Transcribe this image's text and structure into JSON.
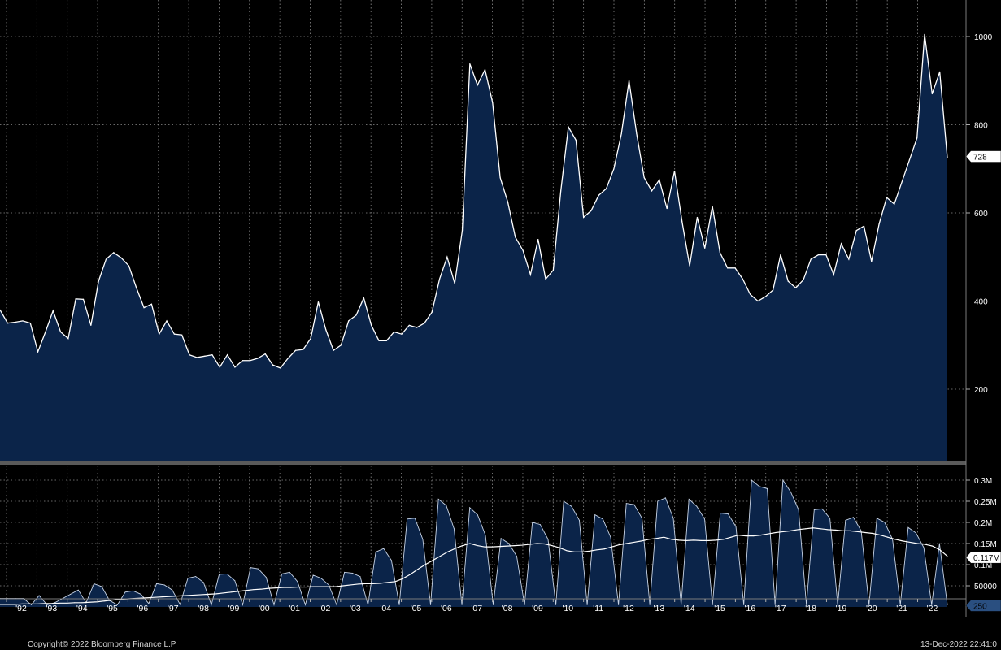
{
  "chart_data": [
    {
      "type": "area",
      "panel": "upper",
      "title": "",
      "xlabel": "",
      "ylabel": "",
      "ylim": [
        50,
        1050
      ],
      "yticks": [
        200,
        400,
        600,
        800,
        1000
      ],
      "grid": true,
      "legend": "none",
      "last_value_label": "728",
      "series": [
        {
          "values": [
            380,
            350,
            352,
            355,
            350,
            285,
            330,
            378,
            330,
            315,
            405,
            404,
            345,
            445,
            495,
            510,
            498,
            480,
            430,
            385,
            393,
            325,
            355,
            325,
            323,
            278,
            272,
            275,
            278,
            250,
            278,
            250,
            265,
            265,
            270,
            280,
            255,
            248,
            270,
            288,
            290,
            315,
            398,
            335,
            288,
            300,
            355,
            368,
            407,
            345,
            310,
            310,
            330,
            325,
            345,
            340,
            350,
            375,
            450,
            500,
            440,
            560,
            938,
            890,
            925,
            850,
            680,
            625,
            545,
            515,
            460,
            540,
            450,
            470,
            650,
            795,
            765,
            590,
            605,
            640,
            655,
            700,
            780,
            900,
            780,
            680,
            650,
            675,
            610,
            695,
            580,
            480,
            590,
            520,
            615,
            510,
            475,
            475,
            450,
            415,
            400,
            410,
            425,
            505,
            445,
            430,
            448,
            495,
            505,
            505,
            460,
            530,
            495,
            560,
            570,
            490,
            575,
            635,
            620,
            670,
            720,
            770,
            1005,
            870,
            920,
            725
          ],
          "color": "#ffffff"
        }
      ]
    },
    {
      "type": "area",
      "panel": "lower",
      "title": "",
      "xlabel": "",
      "ylabel": "",
      "ylim": [
        0,
        300000
      ],
      "yticks": [
        "0.3M",
        "0.25M",
        "0.2M",
        "0.15M",
        "0.1M",
        "50000"
      ],
      "grid": true,
      "legend": "none",
      "last_value_labels": [
        "0.117M",
        "250"
      ],
      "series": [
        {
          "values": [
            20000,
            20000,
            20000,
            20000,
            5000,
            27000,
            5000,
            10000,
            20000,
            30000,
            40000,
            10000,
            55000,
            48000,
            15000,
            5000,
            35000,
            38000,
            30000,
            8000,
            55000,
            52000,
            40000,
            6000,
            68000,
            72000,
            58000,
            5000,
            77000,
            78000,
            62000,
            5000,
            93000,
            90000,
            70000,
            5000,
            78000,
            82000,
            60000,
            5000,
            75000,
            68000,
            52000,
            5000,
            82000,
            80000,
            72000,
            5000,
            130000,
            138000,
            110000,
            5000,
            208000,
            210000,
            160000,
            5000,
            255000,
            240000,
            185000,
            5000,
            235000,
            218000,
            170000,
            5000,
            162000,
            150000,
            120000,
            5000,
            200000,
            195000,
            160000,
            5000,
            250000,
            238000,
            205000,
            5000,
            218000,
            208000,
            165000,
            5000,
            245000,
            242000,
            210000,
            5000,
            250000,
            258000,
            210000,
            5000,
            255000,
            238000,
            208000,
            5000,
            222000,
            220000,
            190000,
            5000,
            300000,
            285000,
            280000,
            5000,
            300000,
            272000,
            230000,
            5000,
            230000,
            232000,
            210000,
            5000,
            205000,
            212000,
            180000,
            5000,
            210000,
            200000,
            160000,
            5000,
            188000,
            175000,
            140000,
            5000,
            150000,
            5000
          ],
          "color": "#ffffff"
        },
        {
          "values": [
            6000,
            6000,
            6000,
            7000,
            7000,
            7000,
            8000,
            8000,
            9000,
            9000,
            10000,
            10000,
            11000,
            12000,
            14000,
            16000,
            18000,
            19000,
            20000,
            21000,
            22000,
            23000,
            24000,
            25000,
            26000,
            27000,
            28000,
            29000,
            30000,
            31000,
            33000,
            35000,
            37000,
            39000,
            41000,
            42000,
            44000,
            45000,
            46000,
            46000,
            47000,
            47000,
            48000,
            48000,
            48000,
            48000,
            50000,
            52000,
            54000,
            55000,
            55000,
            56000,
            58000,
            60000,
            67000,
            77000,
            89000,
            100000,
            110000,
            120000,
            130000,
            138000,
            145000,
            150000,
            145000,
            142000,
            142000,
            143000,
            144000,
            145000,
            146000,
            148000,
            150000,
            149000,
            145000,
            140000,
            133000,
            130000,
            130000,
            132000,
            135000,
            137000,
            142000,
            147000,
            150000,
            153000,
            156000,
            160000,
            162000,
            165000,
            160000,
            158000,
            157000,
            158000,
            157000,
            157000,
            158000,
            160000,
            165000,
            170000,
            168000,
            168000,
            170000,
            173000,
            176000,
            178000,
            180000,
            183000,
            185000,
            187000,
            185000,
            183000,
            182000,
            180000,
            180000,
            178000,
            176000,
            174000,
            170000,
            165000,
            160000,
            156000,
            153000,
            150000,
            148000,
            144000,
            135000,
            120000
          ],
          "color": "#ffffff"
        }
      ],
      "categories": [
        "'92",
        "'93",
        "'94",
        "'95",
        "'96",
        "'97",
        "'98",
        "'99",
        "'00",
        "'01",
        "'02",
        "'03",
        "'04",
        "'05",
        "'06",
        "'07",
        "'08",
        "'09",
        "'10",
        "'11",
        "'12",
        "'13",
        "'14",
        "'15",
        "'16",
        "'17",
        "'18",
        "'19",
        "'20",
        "'21",
        "'22"
      ]
    }
  ],
  "footer": {
    "copyright": "Copyright© 2022 Bloomberg Finance L.P.",
    "timestamp": "13-Dec-2022 22:41:0"
  },
  "colors": {
    "background": "#000000",
    "area_fill": "#0b2449",
    "line": "#ffffff",
    "grid": "#8a8a8a",
    "divider": "#5a5a5a"
  }
}
